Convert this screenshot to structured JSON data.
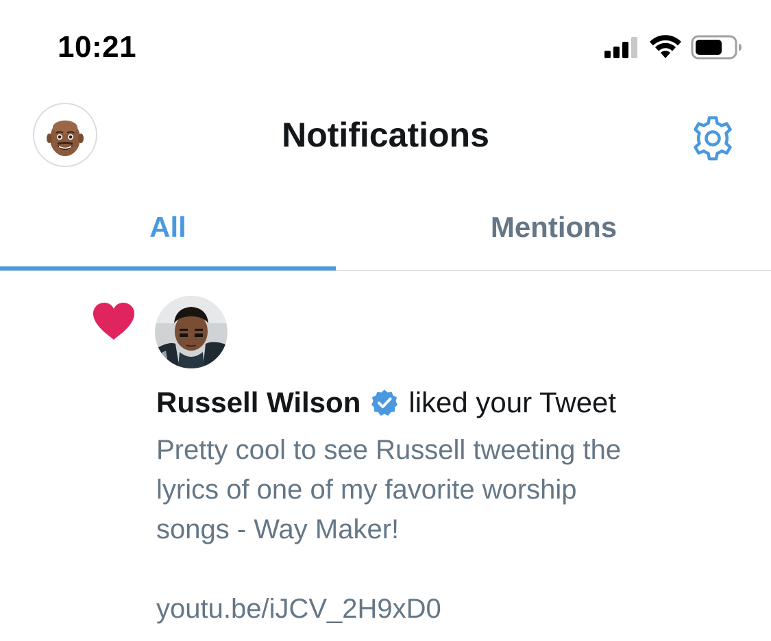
{
  "status_bar": {
    "time": "10:21",
    "signal_icon": "cellular-signal-icon",
    "wifi_icon": "wifi-icon",
    "battery_icon": "battery-icon"
  },
  "header": {
    "title": "Notifications",
    "avatar_icon": "memoji-avatar",
    "settings_icon": "gear-icon"
  },
  "tabs": [
    {
      "label": "All",
      "active": true
    },
    {
      "label": "Mentions",
      "active": false
    }
  ],
  "notification": {
    "icon": "heart-icon",
    "actor_name": "Russell Wilson",
    "verified_icon": "verified-badge-icon",
    "action": "liked your Tweet",
    "tweet_text": "Pretty cool to see Russell tweeting the\nlyrics of one of my favorite worship\nsongs - Way Maker!\n\nyoutu.be/iJCV_2H9xD0"
  },
  "colors": {
    "accent": "#4a99e0",
    "like": "#e0245e",
    "secondary_text": "#657786",
    "primary_text": "#14171a",
    "divider": "#dfe3e7"
  }
}
